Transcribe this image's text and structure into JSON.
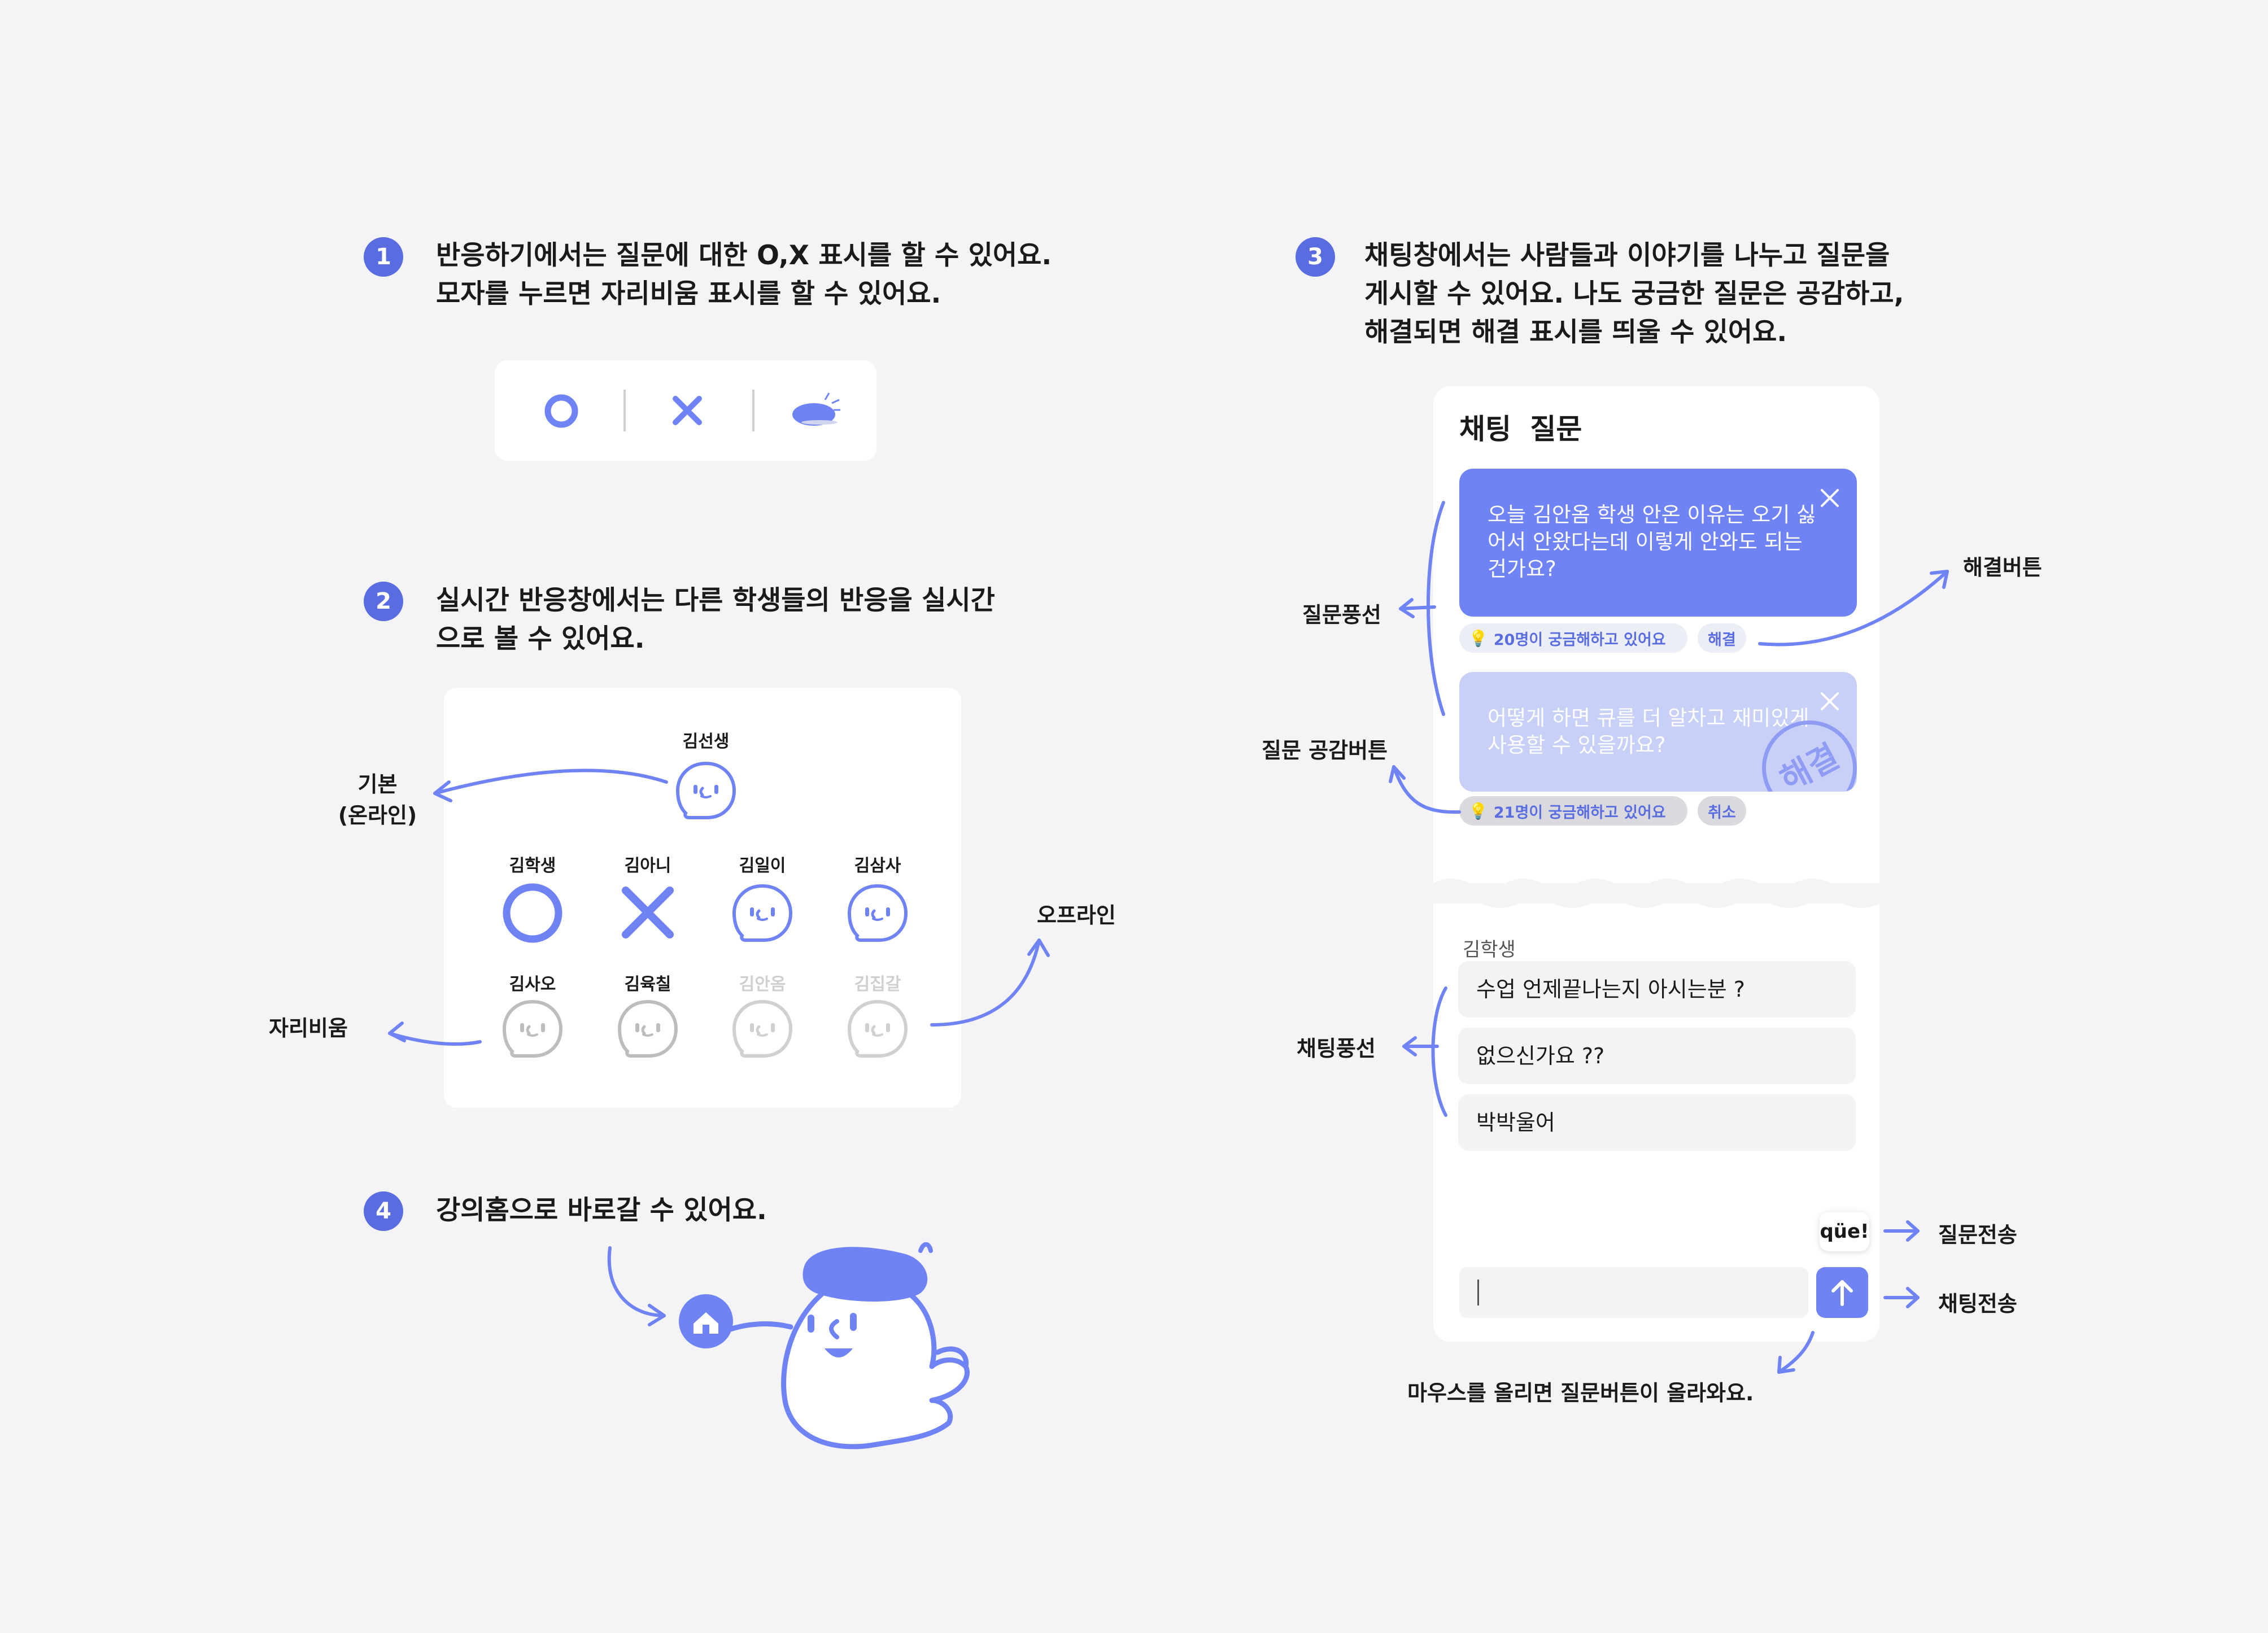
{
  "steps": [
    {
      "num": "1",
      "lines": [
        "반응하기에서는 질문에 대한 O,X 표시를 할 수 있어요.",
        "모자를 누르면 자리비움 표시를 할 수 있어요."
      ]
    },
    {
      "num": "2",
      "lines": [
        "실시간 반응창에서는 다른 학생들의 반응을 실시간",
        "으로 볼 수 있어요."
      ]
    },
    {
      "num": "3",
      "lines": [
        "채팅창에서는 사람들과 이야기를 나누고 질문을",
        "게시할 수 있어요. 나도 궁금한 질문은 공감하고,",
        "해결되면 해결 표시를 띄울 수 있어요."
      ]
    },
    {
      "num": "4",
      "lines": [
        "강의홈으로 바로갈 수 있어요."
      ]
    }
  ],
  "reaction_bar": {
    "icons": [
      "o-icon",
      "x-icon",
      "beret-hat-icon"
    ]
  },
  "realtime": {
    "teacher": "김선생",
    "students_row1": [
      "김학생",
      "김아니",
      "김일이",
      "김삼사"
    ],
    "students_row2": [
      "김사오",
      "김육칠",
      "김안옴",
      "김집갈"
    ],
    "callouts": {
      "basic": [
        "기본",
        "(온라인)"
      ],
      "away": "자리비움",
      "offline": "오프라인"
    }
  },
  "chat": {
    "tabs": [
      "채팅",
      "질문"
    ],
    "questions": [
      {
        "text": [
          "오늘 김안옴 학생 안온 이유는 오기 싫",
          "어서 안왔다는데 이렇게 안와도 되는",
          "건가요?"
        ],
        "empathy": "20명이 궁금해하고 있어요",
        "action": "해결"
      },
      {
        "text": [
          "어떻게 하면 큐를 더 알차고 재미있게",
          "사용할 수 있을까요?"
        ],
        "empathy": "21명이 궁금해하고 있어요",
        "action": "취소",
        "stamp": "해결"
      }
    ],
    "sender": "김학생",
    "messages": [
      "수업 언제끝나는지 아시는분 ?",
      "없으신가요 ??",
      "박박울어"
    ],
    "que_logo": "qüe!",
    "callouts": {
      "question_bubble": "질문풍선",
      "empathy_button": "질문 공감버튼",
      "resolve_button": "해결버튼",
      "chat_bubble": "채팅풍선",
      "send_question": "질문전송",
      "send_chat": "채팅전송",
      "hover_note": "마우스를 올리면 질문버튼이 올라와요."
    }
  },
  "colors": {
    "accent": "#5a6de0",
    "accent_light": "#6f83f5",
    "faded_bubble": "#c9d0f7",
    "background": "#f4f4f6"
  }
}
